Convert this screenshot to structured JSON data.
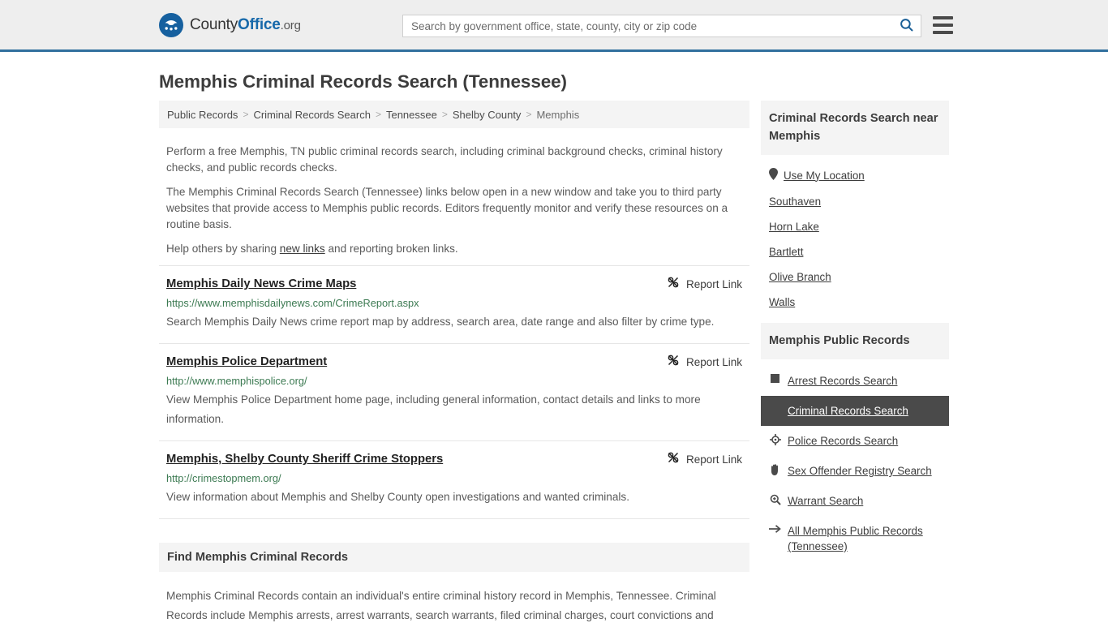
{
  "header": {
    "brand": {
      "part1": "County",
      "part2": "Office",
      "part3": ".org"
    },
    "search": {
      "placeholder": "Search by government office, state, county, city or zip code",
      "value": "",
      "icon": "search-icon"
    },
    "menu_icon": "hamburger-menu-icon",
    "accent_color": "#31709e"
  },
  "page": {
    "title": "Memphis Criminal Records Search (Tennessee)"
  },
  "breadcrumb": {
    "items": [
      {
        "label": "Public Records",
        "current": false
      },
      {
        "label": "Criminal Records Search",
        "current": false
      },
      {
        "label": "Tennessee",
        "current": false
      },
      {
        "label": "Shelby County",
        "current": false
      },
      {
        "label": "Memphis",
        "current": true
      }
    ],
    "separator": ">"
  },
  "intro": {
    "p1": "Perform a free Memphis, TN public criminal records search, including criminal background checks, criminal history checks, and public records checks.",
    "p2": "The Memphis Criminal Records Search (Tennessee) links below open in a new window and take you to third party websites that provide access to Memphis public records. Editors frequently monitor and verify these resources on a routine basis.",
    "p3_before": "Help others by sharing ",
    "p3_link": "new links",
    "p3_after": " and reporting broken links."
  },
  "links": {
    "report_label": "Report Link",
    "report_icon": "broken-link-icon",
    "items": [
      {
        "title": "Memphis Daily News Crime Maps",
        "url": "https://www.memphisdailynews.com/CrimeReport.aspx",
        "description": "Search Memphis Daily News crime report map by address, search area, date range and also filter by crime type."
      },
      {
        "title": "Memphis Police Department",
        "url": "http://www.memphispolice.org/",
        "description": "View Memphis Police Department home page, including general information, contact details and links to more information."
      },
      {
        "title": "Memphis, Shelby County Sheriff Crime Stoppers",
        "url": "http://crimestopmem.org/",
        "description": "View information about Memphis and Shelby County open investigations and wanted criminals."
      }
    ]
  },
  "find_section": {
    "heading": "Find Memphis Criminal Records",
    "paragraph": "Memphis Criminal Records contain an individual's entire criminal history record in Memphis, Tennessee. Criminal Records include Memphis arrests, arrest warrants, search warrants, filed criminal charges, court convictions and"
  },
  "sidebar": {
    "nearby": {
      "heading": "Criminal Records Search near Memphis",
      "items": [
        {
          "label": "Use My Location",
          "icon": "map-pin-icon"
        },
        {
          "label": "Southaven",
          "icon": ""
        },
        {
          "label": "Horn Lake",
          "icon": ""
        },
        {
          "label": "Bartlett",
          "icon": ""
        },
        {
          "label": "Olive Branch",
          "icon": ""
        },
        {
          "label": "Walls",
          "icon": ""
        }
      ]
    },
    "public_records": {
      "heading": "Memphis Public Records",
      "active_color": "#4a4a4a",
      "items": [
        {
          "label": "Arrest Records Search",
          "icon": "fingerprint-card-icon",
          "active": false
        },
        {
          "label": "Criminal Records Search",
          "icon": "exclamation-icon",
          "active": true
        },
        {
          "label": "Police Records Search",
          "icon": "police-badge-icon",
          "active": false
        },
        {
          "label": "Sex Offender Registry Search",
          "icon": "hand-icon",
          "active": false
        },
        {
          "label": "Warrant Search",
          "icon": "magnifier-plus-icon",
          "active": false
        },
        {
          "label": "All Memphis Public Records (Tennessee)",
          "icon": "arrow-right-icon",
          "active": false
        }
      ]
    }
  }
}
